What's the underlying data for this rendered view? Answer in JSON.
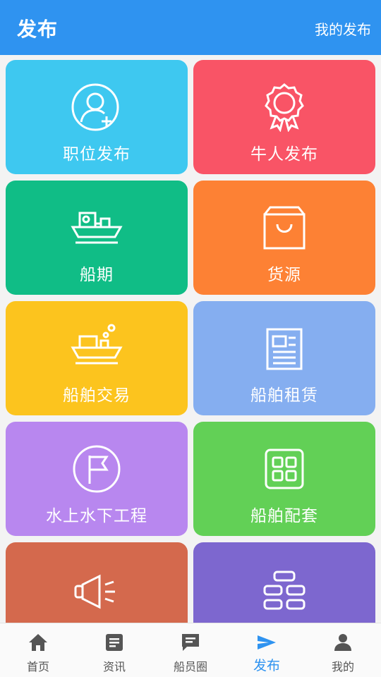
{
  "header": {
    "title": "发布",
    "my_posts": "我的发布"
  },
  "colors": {
    "accent": "#2f93f0",
    "tiles": [
      "#3ec8f0",
      "#f95466",
      "#10bd86",
      "#fd8134",
      "#fcc41e",
      "#85aef0",
      "#b887ef",
      "#62d056",
      "#d4694d",
      "#7d67cf"
    ]
  },
  "tiles": [
    {
      "label": "职位发布",
      "icon": "person-plus-icon"
    },
    {
      "label": "牛人发布",
      "icon": "award-badge-icon"
    },
    {
      "label": "船期",
      "icon": "ship-icon"
    },
    {
      "label": "货源",
      "icon": "shopping-bag-icon"
    },
    {
      "label": "船舶交易",
      "icon": "ship-bubbles-icon"
    },
    {
      "label": "船舶租赁",
      "icon": "newspaper-icon"
    },
    {
      "label": "水上水下工程",
      "icon": "flag-circle-icon"
    },
    {
      "label": "船舶配套",
      "icon": "grid-icon"
    },
    {
      "label": "",
      "icon": "megaphone-icon"
    },
    {
      "label": "",
      "icon": "stacked-blocks-icon"
    }
  ],
  "tabbar": [
    {
      "label": "首页",
      "icon": "home-icon"
    },
    {
      "label": "资讯",
      "icon": "news-icon"
    },
    {
      "label": "船员圈",
      "icon": "chat-icon"
    },
    {
      "label": "发布",
      "icon": "send-icon",
      "active": true
    },
    {
      "label": "我的",
      "icon": "person-icon"
    }
  ]
}
